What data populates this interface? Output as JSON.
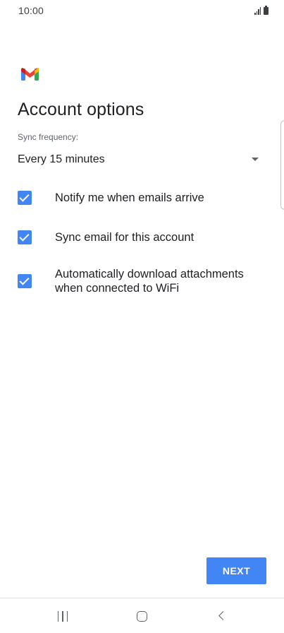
{
  "status_bar": {
    "time": "10:00",
    "signal_icon": "signal-icon",
    "battery_icon": "battery-icon"
  },
  "header": {
    "logo_icon": "gmail-logo-icon",
    "title": "Account options"
  },
  "sync": {
    "label": "Sync frequency:",
    "value": "Every 15 minutes",
    "icon": "dropdown-arrow-icon"
  },
  "options": [
    {
      "label": "Notify me when emails arrive",
      "checked": true
    },
    {
      "label": "Sync email for this account",
      "checked": true
    },
    {
      "label": "Automatically download attachments when connected to WiFi",
      "checked": true
    }
  ],
  "actions": {
    "next_label": "NEXT"
  },
  "nav_bar": {
    "recents_icon": "recents-icon",
    "home_icon": "home-icon",
    "back_icon": "back-icon"
  },
  "colors": {
    "accent": "#4285f4",
    "text_primary": "#202124",
    "text_secondary": "#5f6368",
    "gmail_red": "#ea4335",
    "gmail_blue": "#4285f4",
    "gmail_green": "#34a853",
    "gmail_yellow": "#fbbc04"
  }
}
